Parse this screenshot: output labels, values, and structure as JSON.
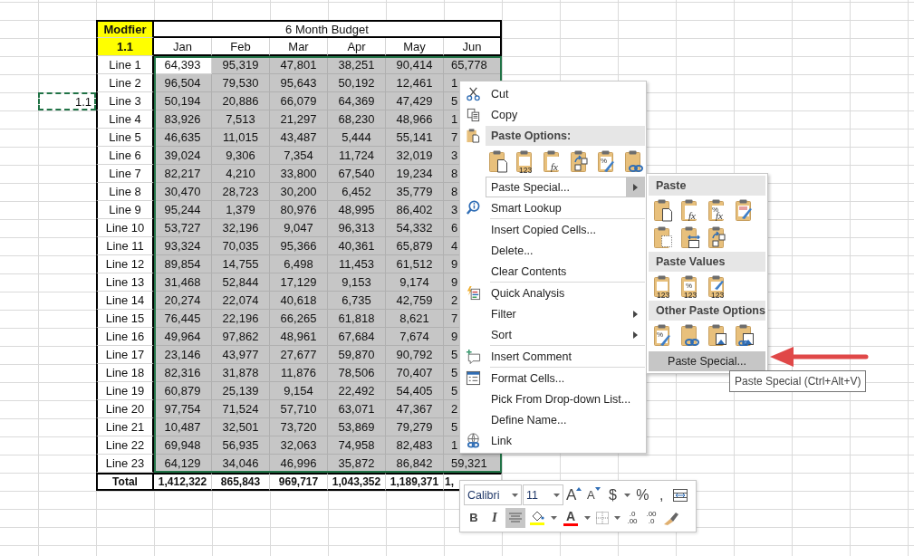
{
  "sheet": {
    "copied_cell": "1.1"
  },
  "table": {
    "modifier_label": "Modfier",
    "modifier_value": "1.1",
    "title": "6 Month Budget",
    "columns": [
      "Jan",
      "Feb",
      "Mar",
      "Apr",
      "May",
      "Jun"
    ],
    "rows": [
      {
        "label": "Line 1",
        "selected": true,
        "active": true,
        "values": [
          "64,393",
          "95,319",
          "47,801",
          "38,251",
          "90,414",
          "65,778"
        ]
      },
      {
        "label": "Line 2",
        "selected": true,
        "active": false,
        "values": [
          "96,504",
          "79,530",
          "95,643",
          "50,192",
          "12,461",
          "1"
        ]
      },
      {
        "label": "Line 3",
        "selected": true,
        "active": false,
        "values": [
          "50,194",
          "20,886",
          "66,079",
          "64,369",
          "47,429",
          "5"
        ]
      },
      {
        "label": "Line 4",
        "selected": true,
        "active": false,
        "values": [
          "83,926",
          "7,513",
          "21,297",
          "68,230",
          "48,966",
          "1"
        ]
      },
      {
        "label": "Line 5",
        "selected": true,
        "active": false,
        "values": [
          "46,635",
          "11,015",
          "43,487",
          "5,444",
          "55,141",
          "7"
        ]
      },
      {
        "label": "Line 6",
        "selected": true,
        "active": false,
        "values": [
          "39,024",
          "9,306",
          "7,354",
          "11,724",
          "32,019",
          "3"
        ]
      },
      {
        "label": "Line 7",
        "selected": true,
        "active": false,
        "values": [
          "82,217",
          "4,210",
          "33,800",
          "67,540",
          "19,234",
          "8"
        ]
      },
      {
        "label": "Line 8",
        "selected": true,
        "active": false,
        "values": [
          "30,470",
          "28,723",
          "30,200",
          "6,452",
          "35,779",
          "8"
        ]
      },
      {
        "label": "Line 9",
        "selected": true,
        "active": false,
        "values": [
          "95,244",
          "1,379",
          "80,976",
          "48,995",
          "86,402",
          "3"
        ]
      },
      {
        "label": "Line 10",
        "selected": true,
        "active": false,
        "values": [
          "53,727",
          "32,196",
          "9,047",
          "96,313",
          "54,332",
          "6"
        ]
      },
      {
        "label": "Line 11",
        "selected": true,
        "active": false,
        "values": [
          "93,324",
          "70,035",
          "95,366",
          "40,361",
          "65,879",
          "4"
        ]
      },
      {
        "label": "Line 12",
        "selected": true,
        "active": false,
        "values": [
          "89,854",
          "14,755",
          "6,498",
          "11,453",
          "61,512",
          "9"
        ]
      },
      {
        "label": "Line 13",
        "selected": true,
        "active": false,
        "values": [
          "31,468",
          "52,844",
          "17,129",
          "9,153",
          "9,174",
          "9"
        ]
      },
      {
        "label": "Line 14",
        "selected": true,
        "active": false,
        "values": [
          "20,274",
          "22,074",
          "40,618",
          "6,735",
          "42,759",
          "2"
        ]
      },
      {
        "label": "Line 15",
        "selected": true,
        "active": false,
        "values": [
          "76,445",
          "22,196",
          "66,265",
          "61,818",
          "8,621",
          "7"
        ]
      },
      {
        "label": "Line 16",
        "selected": true,
        "active": false,
        "values": [
          "49,964",
          "97,862",
          "48,961",
          "67,684",
          "7,674",
          "9"
        ]
      },
      {
        "label": "Line 17",
        "selected": true,
        "active": false,
        "values": [
          "23,146",
          "43,977",
          "27,677",
          "59,870",
          "90,792",
          "5"
        ]
      },
      {
        "label": "Line 18",
        "selected": true,
        "active": false,
        "values": [
          "82,316",
          "31,878",
          "11,876",
          "78,506",
          "70,407",
          "5"
        ]
      },
      {
        "label": "Line 19",
        "selected": true,
        "active": false,
        "values": [
          "60,879",
          "25,139",
          "9,154",
          "22,492",
          "54,405",
          "5"
        ]
      },
      {
        "label": "Line 20",
        "selected": true,
        "active": false,
        "values": [
          "97,754",
          "71,524",
          "57,710",
          "63,071",
          "47,367",
          "2"
        ]
      },
      {
        "label": "Line 21",
        "selected": true,
        "active": false,
        "values": [
          "10,487",
          "32,501",
          "73,720",
          "53,869",
          "79,279",
          "5"
        ]
      },
      {
        "label": "Line 22",
        "selected": true,
        "active": false,
        "values": [
          "69,948",
          "56,935",
          "32,063",
          "74,958",
          "82,483",
          "1"
        ]
      },
      {
        "label": "Line 23",
        "selected": true,
        "active": false,
        "values": [
          "64,129",
          "34,046",
          "46,996",
          "35,872",
          "86,842",
          "59,321"
        ]
      }
    ],
    "total": {
      "label": "Total",
      "values": [
        "1,412,322",
        "865,843",
        "969,717",
        "1,043,352",
        "1,189,371",
        "1,"
      ]
    }
  },
  "context_menu": {
    "items": [
      {
        "kind": "item",
        "label": "Cut",
        "submenu": false,
        "selected": false
      },
      {
        "kind": "item",
        "label": "Copy",
        "submenu": false,
        "selected": false
      },
      {
        "kind": "header",
        "label": "Paste Options:"
      },
      {
        "kind": "icons",
        "icons": [
          {
            "kind": "page"
          },
          {
            "kind": "values",
            "badge": "123"
          },
          {
            "kind": "formulas",
            "badge": "fx"
          },
          {
            "kind": "transpose"
          },
          {
            "kind": "formatting",
            "badge": "%"
          },
          {
            "kind": "link"
          }
        ]
      },
      {
        "kind": "item",
        "label": "Paste Special...",
        "submenu": true,
        "selected": true
      },
      {
        "kind": "item",
        "label": "Smart Lookup",
        "submenu": false,
        "selected": false
      },
      {
        "kind": "separator"
      },
      {
        "kind": "item",
        "label": "Insert Copied Cells...",
        "submenu": false,
        "selected": false
      },
      {
        "kind": "item",
        "label": "Delete...",
        "submenu": false,
        "selected": false
      },
      {
        "kind": "item",
        "label": "Clear Contents",
        "submenu": false,
        "selected": false
      },
      {
        "kind": "separator"
      },
      {
        "kind": "item",
        "label": "Quick Analysis",
        "submenu": false,
        "selected": false
      },
      {
        "kind": "item",
        "label": "Filter",
        "submenu": true,
        "selected": false
      },
      {
        "kind": "item",
        "label": "Sort",
        "submenu": true,
        "selected": false
      },
      {
        "kind": "separator"
      },
      {
        "kind": "item",
        "label": "Insert Comment",
        "submenu": false,
        "selected": false
      },
      {
        "kind": "separator"
      },
      {
        "kind": "item",
        "label": "Format Cells...",
        "submenu": false,
        "selected": false
      },
      {
        "kind": "item",
        "label": "Pick From Drop-down List...",
        "submenu": false,
        "selected": false
      },
      {
        "kind": "item",
        "label": "Define Name...",
        "submenu": false,
        "selected": false
      },
      {
        "kind": "item",
        "label": "Link",
        "submenu": false,
        "selected": false
      }
    ]
  },
  "paste_submenu": {
    "sections": [
      {
        "title": "Paste",
        "icons": [
          {
            "kind": "page"
          },
          {
            "kind": "formulas",
            "badge": "fx"
          },
          {
            "kind": "formulas",
            "badge": "fx",
            "badge2": "%"
          },
          {
            "kind": "source-formatting"
          },
          {
            "kind": "no-borders"
          },
          {
            "kind": "column-widths"
          },
          {
            "kind": "transpose"
          }
        ]
      },
      {
        "title": "Paste Values",
        "icons": [
          {
            "kind": "values",
            "badge": "123"
          },
          {
            "kind": "values",
            "badge": "123",
            "badge2": "%"
          },
          {
            "kind": "values-brush",
            "badge": "123"
          }
        ]
      },
      {
        "title": "Other Paste Options",
        "icons": [
          {
            "kind": "formatting",
            "badge": "%"
          },
          {
            "kind": "link"
          },
          {
            "kind": "picture"
          },
          {
            "kind": "linked-picture"
          }
        ]
      }
    ],
    "footer": {
      "label": "Paste Special...",
      "selected": true
    }
  },
  "tooltip": "Paste Special (Ctrl+Alt+V)",
  "mini_toolbar": {
    "font": "Calibri",
    "size": "11",
    "row_1": [
      {
        "kind": "grow",
        "label": "A"
      },
      {
        "kind": "shrink",
        "label": "A"
      },
      {
        "kind": "currency",
        "label": "$"
      },
      {
        "kind": "percent",
        "label": "%"
      },
      {
        "kind": "comma",
        "label": ","
      },
      {
        "kind": "merge"
      }
    ],
    "row_2": [
      {
        "kind": "bold",
        "label": "B",
        "on": false
      },
      {
        "kind": "italic",
        "label": "I",
        "on": false
      },
      {
        "kind": "align",
        "on": true
      },
      {
        "kind": "fill",
        "color": "#ffff00"
      },
      {
        "kind": "font-color",
        "label": "A",
        "color": "#ff0000"
      },
      {
        "kind": "borders"
      },
      {
        "kind": "decimal",
        "top": ".0",
        "bottom": ".00"
      },
      {
        "kind": "decimal",
        "top": ".00",
        "bottom": ".0"
      },
      {
        "kind": "painter"
      }
    ]
  }
}
